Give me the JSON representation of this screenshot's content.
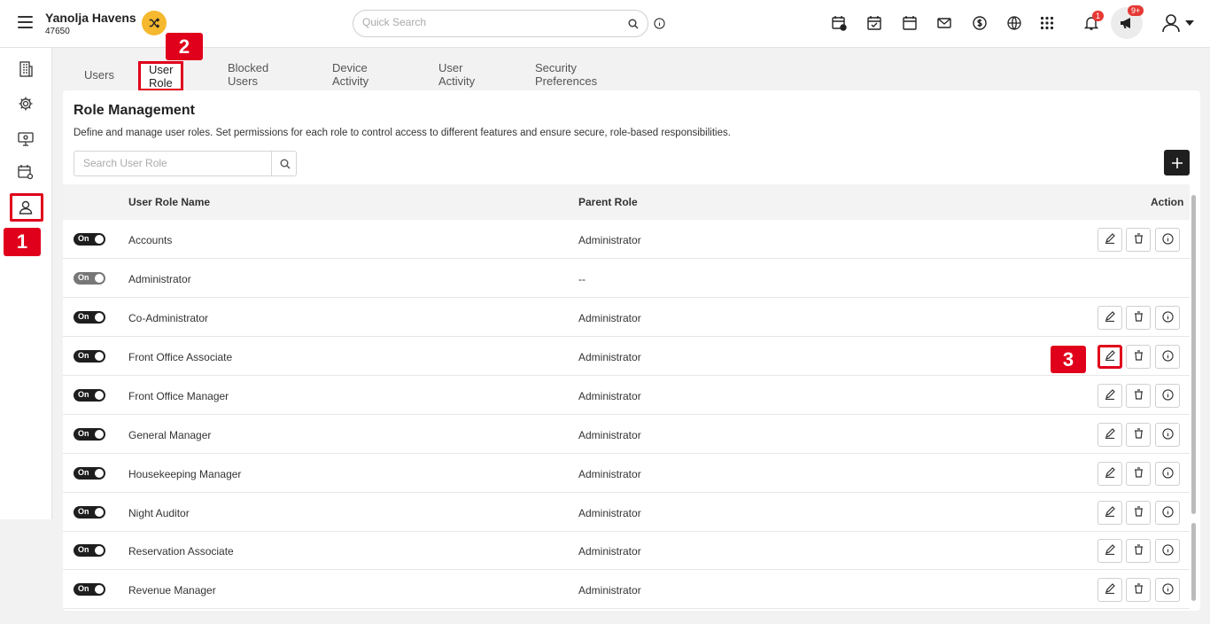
{
  "header": {
    "hotel_name": "Yanolja Havens",
    "hotel_id": "47650",
    "search_placeholder": "Quick Search",
    "notification_count": "1",
    "announcement_count": "9+"
  },
  "tabs": [
    {
      "label": "Users"
    },
    {
      "label": "User Role"
    },
    {
      "label": "Blocked Users"
    },
    {
      "label": "Device Activity"
    },
    {
      "label": "User Activity"
    },
    {
      "label": "Security Preferences"
    }
  ],
  "page": {
    "title": "Role Management",
    "description": "Define and manage user roles. Set permissions for each role to control access to different features and ensure secure, role-based responsibilities.",
    "search_placeholder": "Search User Role"
  },
  "table": {
    "col_name": "User Role Name",
    "col_parent": "Parent Role",
    "col_action": "Action",
    "rows": [
      {
        "toggle": "On",
        "name": "Accounts",
        "parent": "Administrator"
      },
      {
        "toggle": "On",
        "name": "Administrator",
        "parent": "--"
      },
      {
        "toggle": "On",
        "name": "Co-Administrator",
        "parent": "Administrator"
      },
      {
        "toggle": "On",
        "name": "Front Office Associate",
        "parent": "Administrator"
      },
      {
        "toggle": "On",
        "name": "Front Office Manager",
        "parent": "Administrator"
      },
      {
        "toggle": "On",
        "name": "General Manager",
        "parent": "Administrator"
      },
      {
        "toggle": "On",
        "name": "Housekeeping Manager",
        "parent": "Administrator"
      },
      {
        "toggle": "On",
        "name": "Night Auditor",
        "parent": "Administrator"
      },
      {
        "toggle": "On",
        "name": "Reservation Associate",
        "parent": "Administrator"
      },
      {
        "toggle": "On",
        "name": "Revenue Manager",
        "parent": "Administrator"
      }
    ]
  },
  "callouts": {
    "one": "1",
    "two": "2",
    "three": "3"
  }
}
